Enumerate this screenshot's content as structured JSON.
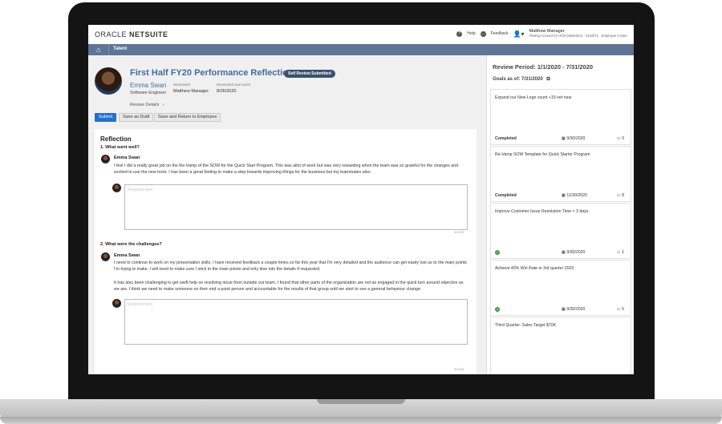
{
  "header": {
    "logo_brand": "ORACLE",
    "logo_product": "NETSUITE",
    "help": "Help",
    "feedback": "Feedback",
    "user_name": "Matthew Manager",
    "user_account": "Testing Account for HCM (Waterloo) - 4116071 · Employee Center"
  },
  "nav": {
    "talent": "Talent"
  },
  "review": {
    "title": "First Half FY20 Performance Reflection",
    "status": "Self Review Submitted",
    "employee_name": "Emma Swan",
    "employee_role": "Software Engineer",
    "reviewer_label": "REVIEWER",
    "reviewer_value": "Matthew Manager",
    "due_label": "REVIEWER DUE DATE",
    "due_value": "8/26/2020",
    "details_link": "Review Details"
  },
  "actions": {
    "submit": "Submit",
    "save_draft": "Save as Draft",
    "save_return": "Save and Return to Employee"
  },
  "reflection": {
    "section_title": "Reflection",
    "questions": [
      {
        "label": "1. What went well?",
        "author": "Emma Swan",
        "answer": "I feel I did a really great job on the Re-Vamp of the SOW for the Quick Start Program.  This was allot of work but was very rewarding when the team was so grateful for the changes and excited to use the new tools.  I has been a great feeling to make a step towards improving things for the business but my teammates also.",
        "placeholder": "Respond here",
        "counter": "0/1200"
      },
      {
        "label": "2. What were the challenges?",
        "author": "Emma Swan",
        "answer": "I need to continue to work on my presentation skills.  I have received feedback a couple times so far this year that I'm very detailed and the audience can get easily lost as to the main points I'm trying to make.  I will need to make sure I stick to the main points and only dive into the details if requested.",
        "answer2": "It has also been challenging to get swift help on resolving issue from outside our team.  I found that other parts of the organization are not as engaged in the quick turn around objective as we are.  I think we need to make someone on their end a point person and accountable for the results of that group until we start to see a general behaviour change.",
        "placeholder": "Respond here",
        "counter": "0/1200"
      }
    ]
  },
  "side": {
    "review_period": "Review Period: 1/1/2020 - 7/31/2020",
    "goals_as_of": "Goals as of: 7/31/2020",
    "goals": [
      {
        "title": "Expand our New Logo count +15 net new",
        "status": "Completed",
        "date": "9/30/2020",
        "comments": "0"
      },
      {
        "title": "Re-Vamp SOW Template for Quick Starter Program",
        "status": "Completed",
        "date": "11/30/2020",
        "comments": "8"
      },
      {
        "title": "Improve Customer Issue Resolution Time < 3 days",
        "status": "",
        "date": "9/30/2020",
        "comments": "1"
      },
      {
        "title": "Achieve 40% Win Rate in 3rd quarter 2020",
        "status": "",
        "date": "9/30/2020",
        "comments": "5"
      },
      {
        "title": "Third Quarter: Sales Target $70K",
        "status": "",
        "date": "",
        "comments": ""
      }
    ]
  },
  "colors": {
    "nav": "#5e7594",
    "title": "#3f6d9e",
    "primary": "#1f72d1",
    "pill": "#3b5270"
  }
}
